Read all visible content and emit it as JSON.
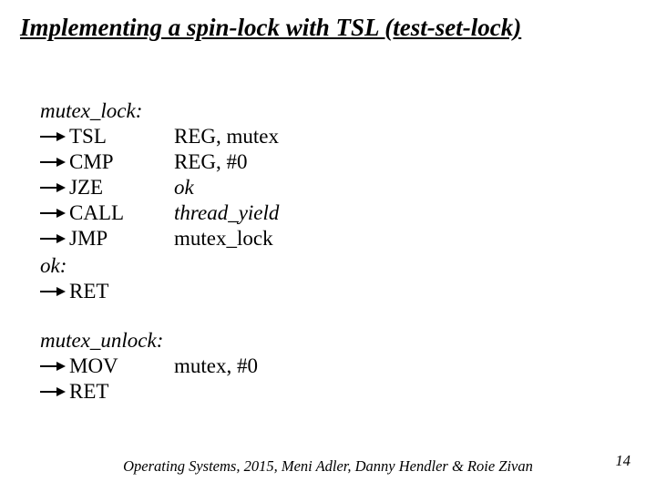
{
  "title": "Implementing a spin-lock with TSL (test-set-lock)",
  "lock": {
    "label": "mutex_lock:",
    "ok_label": "ok:",
    "lines": {
      "tsl": {
        "mnemonic": "TSL",
        "op_plain": "REG, mutex"
      },
      "cmp": {
        "mnemonic": "CMP",
        "op_plain": "REG, #0"
      },
      "jze": {
        "mnemonic": "JZE",
        "op_italic": "ok"
      },
      "call": {
        "mnemonic": "CALL",
        "op_italic": "thread_yield"
      },
      "jmp": {
        "mnemonic": "JMP",
        "op_plain": " mutex_lock"
      },
      "ret": {
        "mnemonic": "RET"
      }
    }
  },
  "unlock": {
    "label": "mutex_unlock:",
    "lines": {
      "mov": {
        "mnemonic": "MOV",
        "op_plain": "mutex, #0"
      },
      "ret": {
        "mnemonic": "RET"
      }
    }
  },
  "footer": "Operating Systems, 2015, Meni Adler, Danny Hendler & Roie Zivan",
  "page_number": "14"
}
